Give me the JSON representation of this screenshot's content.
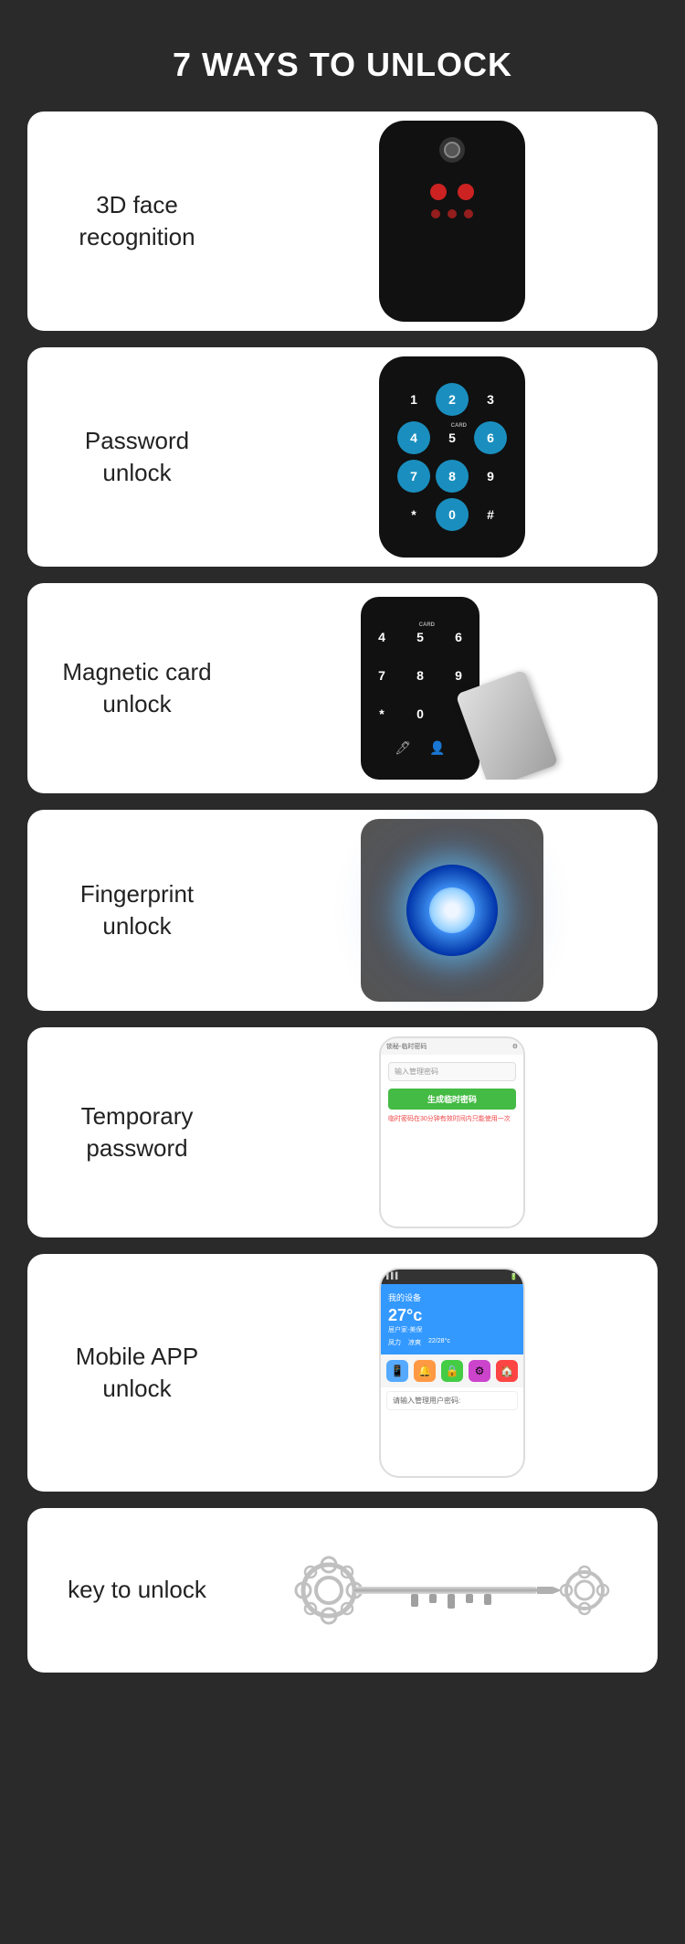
{
  "page": {
    "title": "7 WAYS TO UNLOCK",
    "background": "#2a2a2a"
  },
  "cards": [
    {
      "id": "card-face",
      "label": "3D face\nrecognition",
      "type": "face"
    },
    {
      "id": "card-password",
      "label": "Password\nunlock",
      "type": "keypad",
      "keys": [
        "1",
        "2",
        "3",
        "4",
        "5",
        "6",
        "7",
        "8",
        "9",
        "*",
        "0",
        "#"
      ],
      "highlighted": [
        1,
        3,
        5,
        6,
        7
      ]
    },
    {
      "id": "card-magnetic",
      "label": "Magnetic card\nunlock",
      "type": "magnetic"
    },
    {
      "id": "card-fingerprint",
      "label": "Fingerprint\nunlock",
      "type": "fingerprint"
    },
    {
      "id": "card-temporary",
      "label": "Temporary\npassword",
      "type": "app-temp",
      "app": {
        "topbar": "锁秘-临时密码",
        "settings_icon": "⚙",
        "input_placeholder": "输入管理密码",
        "button": "生成临时密码",
        "hint": "临时密码在30分钟有效时间内只能使用一次"
      }
    },
    {
      "id": "card-mobile-app",
      "label": "Mobile APP\nunlock",
      "type": "app-main",
      "app": {
        "device_name": "我的设备",
        "temperature": "27°c",
        "subtitle": "居户家-美保",
        "date": "22/28°c",
        "label2": "凤力",
        "label3": "凉爽",
        "password_prompt": "请输入管理用户密码:"
      }
    },
    {
      "id": "card-key",
      "label": "key to unlock",
      "type": "key"
    }
  ]
}
